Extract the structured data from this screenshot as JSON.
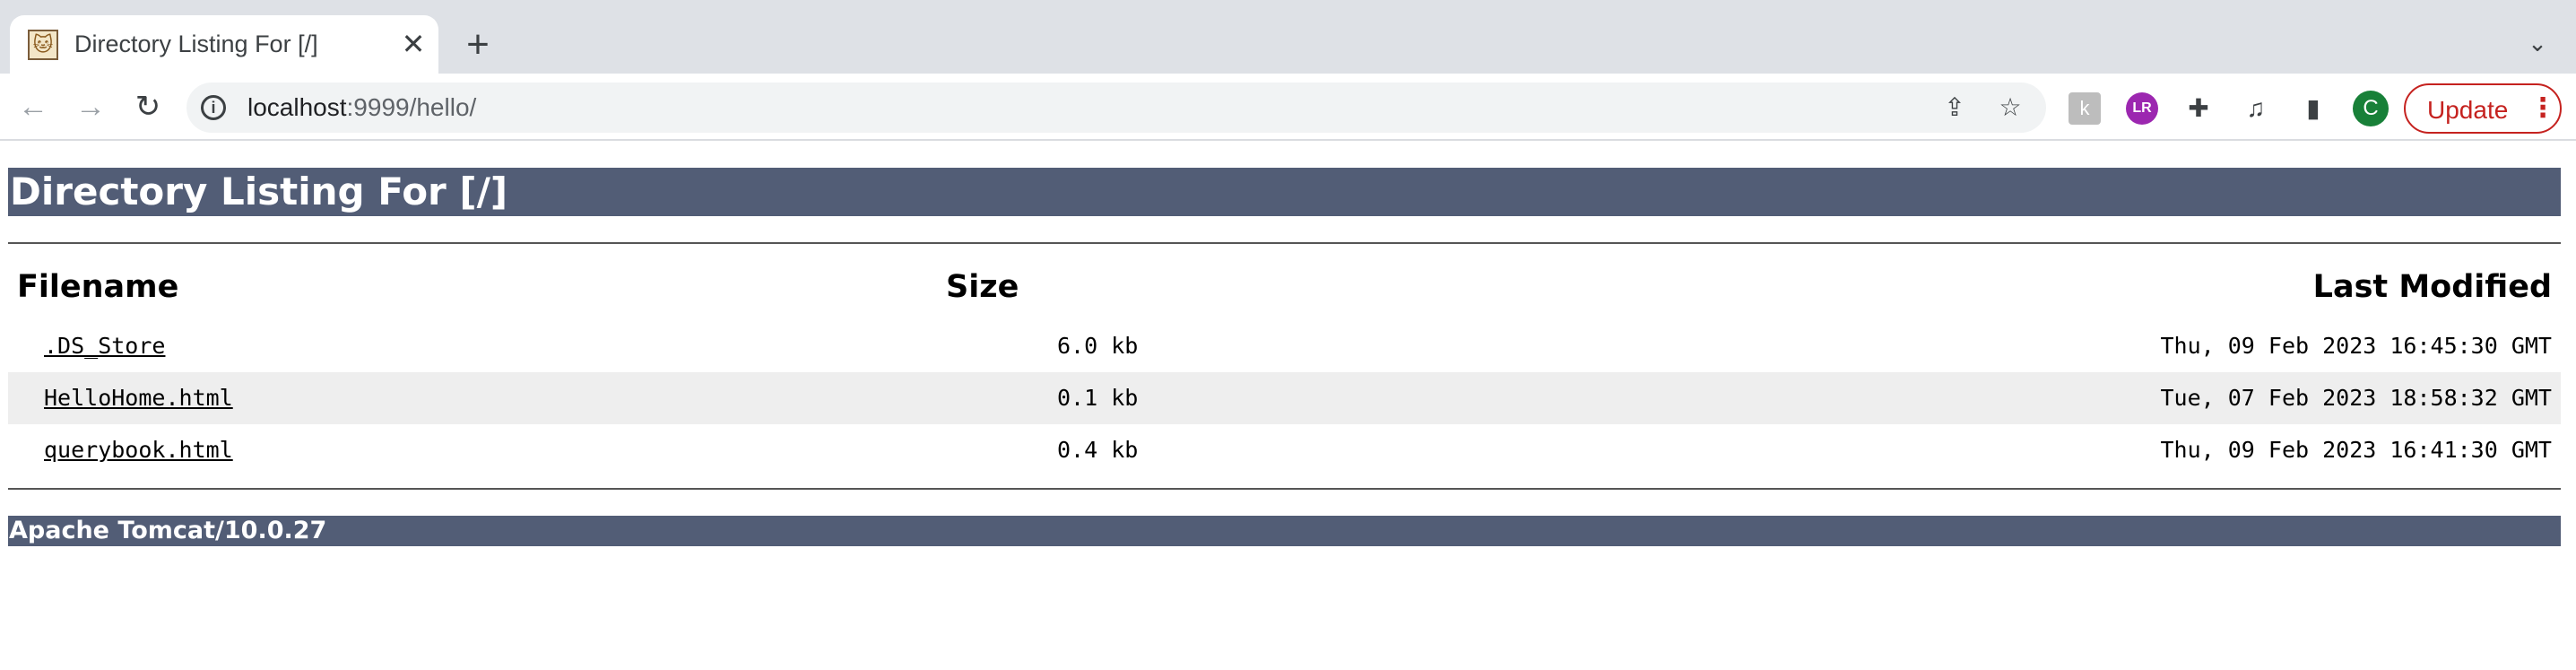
{
  "browser": {
    "tab": {
      "title": "Directory Listing For [/]",
      "favicon": "tomcat-favicon",
      "close_glyph": "✕"
    },
    "new_tab_glyph": "+",
    "tab_search_glyph": "⌄",
    "nav": {
      "back": "←",
      "forward": "→",
      "reload": "↻"
    },
    "omnibox": {
      "info_glyph": "i",
      "url_host": "localhost",
      "url_path": ":9999/hello/",
      "share_glyph": "⇪",
      "bookmark_glyph": "☆"
    },
    "extensions": {
      "k_glyph": "k",
      "lr_glyph": "LR",
      "puzzle_glyph": "✚",
      "media_glyph": "♫",
      "sidepanel_glyph": "▮"
    },
    "profile_initial": "C",
    "update_label": "Update",
    "menu_glyph": "⋮"
  },
  "page": {
    "heading": "Directory Listing For [/]",
    "columns": {
      "filename": "Filename",
      "size": "Size",
      "last_modified": "Last Modified"
    },
    "files": [
      {
        "name": ".DS_Store",
        "size": "6.0 kb",
        "modified": "Thu, 09 Feb 2023 16:45:30 GMT"
      },
      {
        "name": "HelloHome.html",
        "size": "0.1 kb",
        "modified": "Tue, 07 Feb 2023 18:58:32 GMT"
      },
      {
        "name": "querybook.html",
        "size": "0.4 kb",
        "modified": "Thu, 09 Feb 2023 16:41:30 GMT"
      }
    ],
    "footer": "Apache Tomcat/10.0.27"
  },
  "colors": {
    "banner": "#525d76",
    "alt_row": "#eeeeee",
    "update_accent": "#c5221f",
    "avatar": "#188038",
    "lr_extension": "#9c27b0"
  }
}
